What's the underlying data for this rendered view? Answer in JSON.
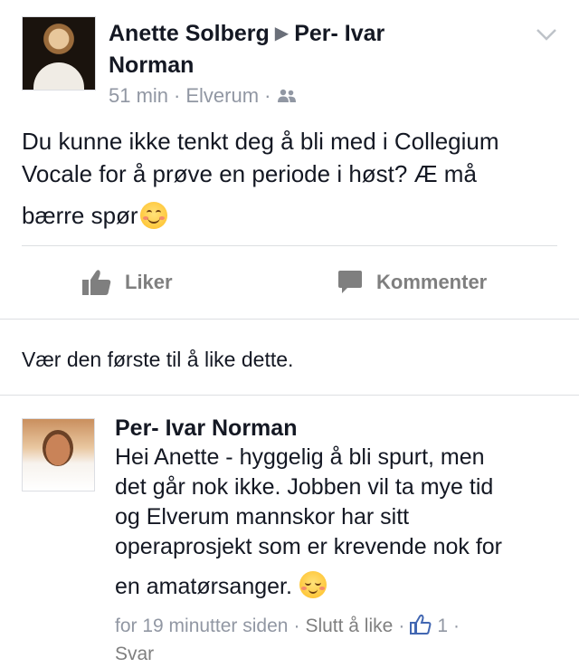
{
  "post": {
    "author": "Anette Solberg",
    "recipient_line1": "Per- Ivar",
    "recipient_line2": "Norman",
    "time": "51 min",
    "location": "Elverum",
    "text_line1": "Du kunne ikke tenkt deg å bli med i Collegium",
    "text_line2": "Vocale for å prøve en periode i høst? Æ må",
    "text_line3": "bærre spør"
  },
  "actions": {
    "like_label": "Liker",
    "comment_label": "Kommenter"
  },
  "likes_summary": "Vær den første til å like dette.",
  "comment": {
    "author": "Per- Ivar Norman",
    "line1": "Hei Anette - hyggelig å bli spurt,  men",
    "line2": "det går nok ikke. Jobben vil ta mye tid",
    "line3": "og Elverum mannskor har sitt",
    "line4": "operaprosjekt som er krevende nok for",
    "line5": "en amatørsanger.",
    "time": "for 19 minutter siden",
    "unlike_label": "Slutt å like",
    "like_count": "1",
    "reply_label": "Svar"
  },
  "colors": {
    "text": "#141823",
    "meta": "#9197a3",
    "action": "#7f7f7f",
    "like_blue": "#4267b2",
    "divider": "#dddfe2"
  },
  "icons": {
    "share_arrow": "triangle-right-icon",
    "options": "chevron-down-icon",
    "audience": "friends-icon",
    "like": "thumbs-up-icon",
    "comment": "speech-bubble-icon",
    "post_emoji": "smiling-face-icon",
    "comment_emoji": "blush-face-icon"
  }
}
